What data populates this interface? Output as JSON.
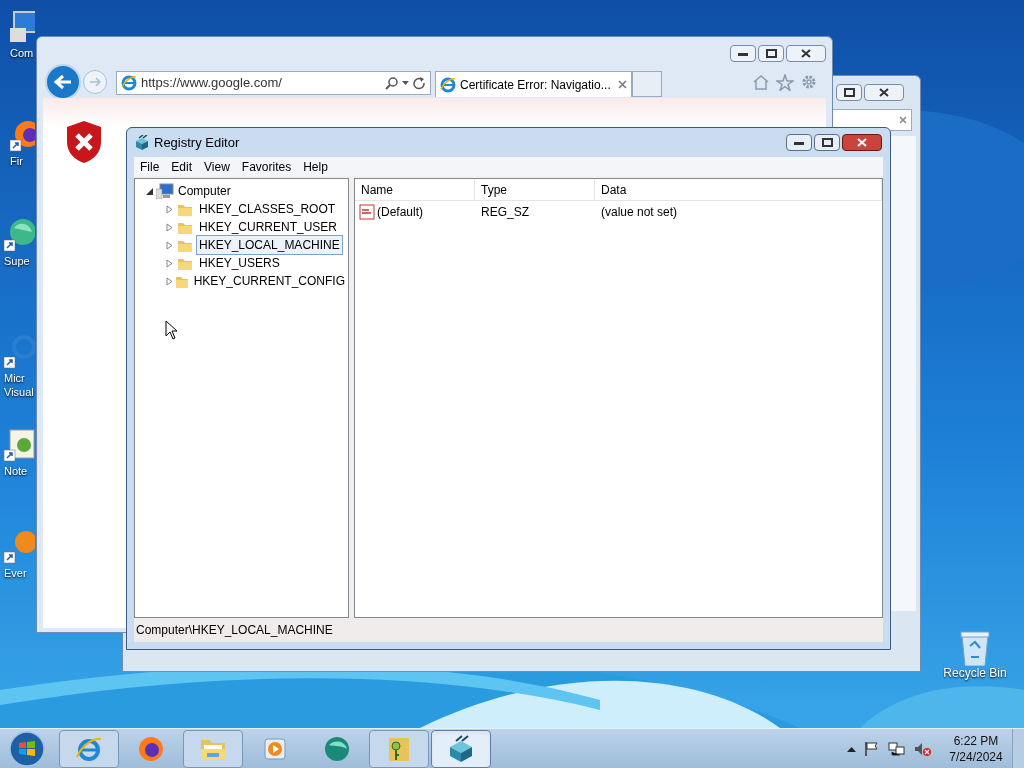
{
  "desktop_icons": [
    {
      "kind": "computer",
      "lines": [
        "Com"
      ]
    },
    {
      "kind": "firefox",
      "lines": [
        "Fir"
      ]
    },
    {
      "kind": "app",
      "lines": [
        "Supe"
      ]
    },
    {
      "kind": "studio",
      "lines": [
        "Micr",
        "Visual"
      ]
    },
    {
      "kind": "notepad",
      "lines": [
        "Note"
      ]
    },
    {
      "kind": "orange",
      "lines": [
        "Ever"
      ]
    },
    {
      "kind": "recycle",
      "lines": [
        "Recycle Bin"
      ]
    }
  ],
  "browser": {
    "address": "https://www.google.com/",
    "tab": "Certificate Error: Navigatio..."
  },
  "registry_editor": {
    "title": "Registry Editor",
    "menu": [
      "File",
      "Edit",
      "View",
      "Favorites",
      "Help"
    ],
    "tree": {
      "label": "Computer",
      "expanded": true,
      "children": [
        {
          "label": "HKEY_CLASSES_ROOT",
          "expanded": false,
          "selected": false
        },
        {
          "label": "HKEY_CURRENT_USER",
          "expanded": false,
          "selected": false
        },
        {
          "label": "HKEY_LOCAL_MACHINE",
          "expanded": false,
          "selected": true
        },
        {
          "label": "HKEY_USERS",
          "expanded": false,
          "selected": false
        },
        {
          "label": "HKEY_CURRENT_CONFIG",
          "expanded": false,
          "selected": false
        }
      ]
    },
    "columns": [
      "Name",
      "Type",
      "Data"
    ],
    "rows": [
      {
        "name": "(Default)",
        "type": "REG_SZ",
        "data": "(value not set)"
      }
    ],
    "status_bar": "Computer\\HKEY_LOCAL_MACHINE"
  },
  "taskbar": {
    "items": [
      {
        "kind": "ie",
        "running": true,
        "selected": false
      },
      {
        "kind": "firefox",
        "running": false,
        "selected": false
      },
      {
        "kind": "explorer",
        "running": true,
        "selected": false
      },
      {
        "kind": "media",
        "running": false,
        "selected": false
      },
      {
        "kind": "circle",
        "running": false,
        "selected": false
      },
      {
        "kind": "keyfolder",
        "running": true,
        "selected": false
      },
      {
        "kind": "regedit",
        "running": true,
        "selected": true
      }
    ],
    "time": "6:22 PM",
    "date": "7/24/2024"
  }
}
